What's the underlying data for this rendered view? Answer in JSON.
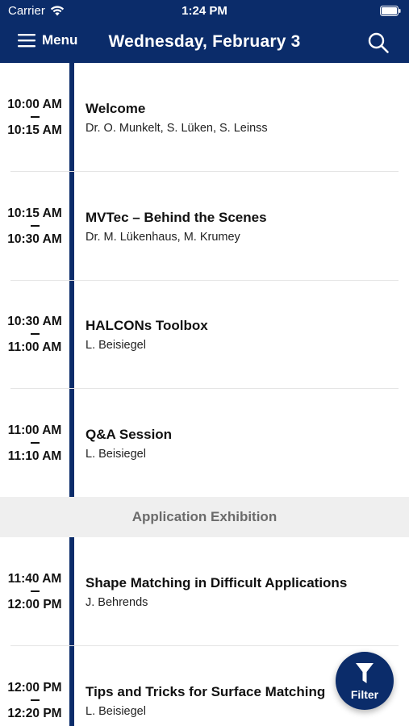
{
  "status_bar": {
    "carrier": "Carrier",
    "time": "1:24 PM"
  },
  "nav": {
    "menu_label": "Menu",
    "title": "Wednesday, February 3"
  },
  "colors": {
    "brand": "#0b2c6a",
    "section_bg": "#efefef"
  },
  "events": [
    {
      "start": "10:00 AM",
      "end": "10:15 AM",
      "title": "Welcome",
      "speakers": "Dr. O. Munkelt, S. Lüken, S. Leinss"
    },
    {
      "start": "10:15 AM",
      "end": "10:30 AM",
      "title": "MVTec – Behind the Scenes",
      "speakers": "Dr. M. Lükenhaus, M. Krumey"
    },
    {
      "start": "10:30 AM",
      "end": "11:00 AM",
      "title": "HALCONs Toolbox",
      "speakers": "L. Beisiegel"
    },
    {
      "start": "11:00 AM",
      "end": "11:10 AM",
      "title": "Q&A Session",
      "speakers": "L. Beisiegel"
    }
  ],
  "section": {
    "title": "Application Exhibition"
  },
  "events2": [
    {
      "start": "11:40 AM",
      "end": "12:00 PM",
      "title": "Shape Matching in Difficult Applications",
      "speakers": "J. Behrends"
    },
    {
      "start": "12:00 PM",
      "end": "12:20 PM",
      "title": "Tips and Tricks for Surface Matching",
      "speakers": "L. Beisiegel"
    }
  ],
  "filter": {
    "label": "Filter",
    "icon": "filter-icon"
  }
}
